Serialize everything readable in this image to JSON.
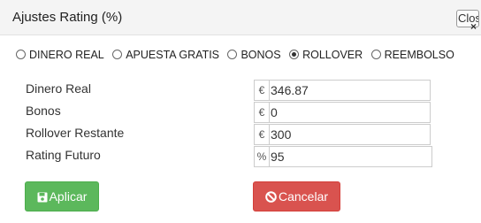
{
  "dialog": {
    "title": "Ajustes Rating (%)",
    "close_label": "Close",
    "close_icon": "×"
  },
  "options": [
    {
      "label": "DINERO REAL",
      "checked": false
    },
    {
      "label": "APUESTA GRATIS",
      "checked": false
    },
    {
      "label": "BONOS",
      "checked": false
    },
    {
      "label": "ROLLOVER",
      "checked": true
    },
    {
      "label": "REEMBOLSO",
      "checked": false
    }
  ],
  "fields": [
    {
      "label": "Dinero Real",
      "addon": "€",
      "value": "346.87"
    },
    {
      "label": "Bonos",
      "addon": "€",
      "value": "0"
    },
    {
      "label": "Rollover Restante",
      "addon": "€",
      "value": "300"
    },
    {
      "label": "Rating Futuro",
      "addon": "%",
      "value": "95"
    }
  ],
  "buttons": {
    "apply_label": "Aplicar",
    "apply_icon": "save-icon",
    "cancel_label": "Cancelar",
    "cancel_icon": "ban-icon"
  },
  "colors": {
    "success": "#5cb85c",
    "danger": "#d9534f"
  }
}
